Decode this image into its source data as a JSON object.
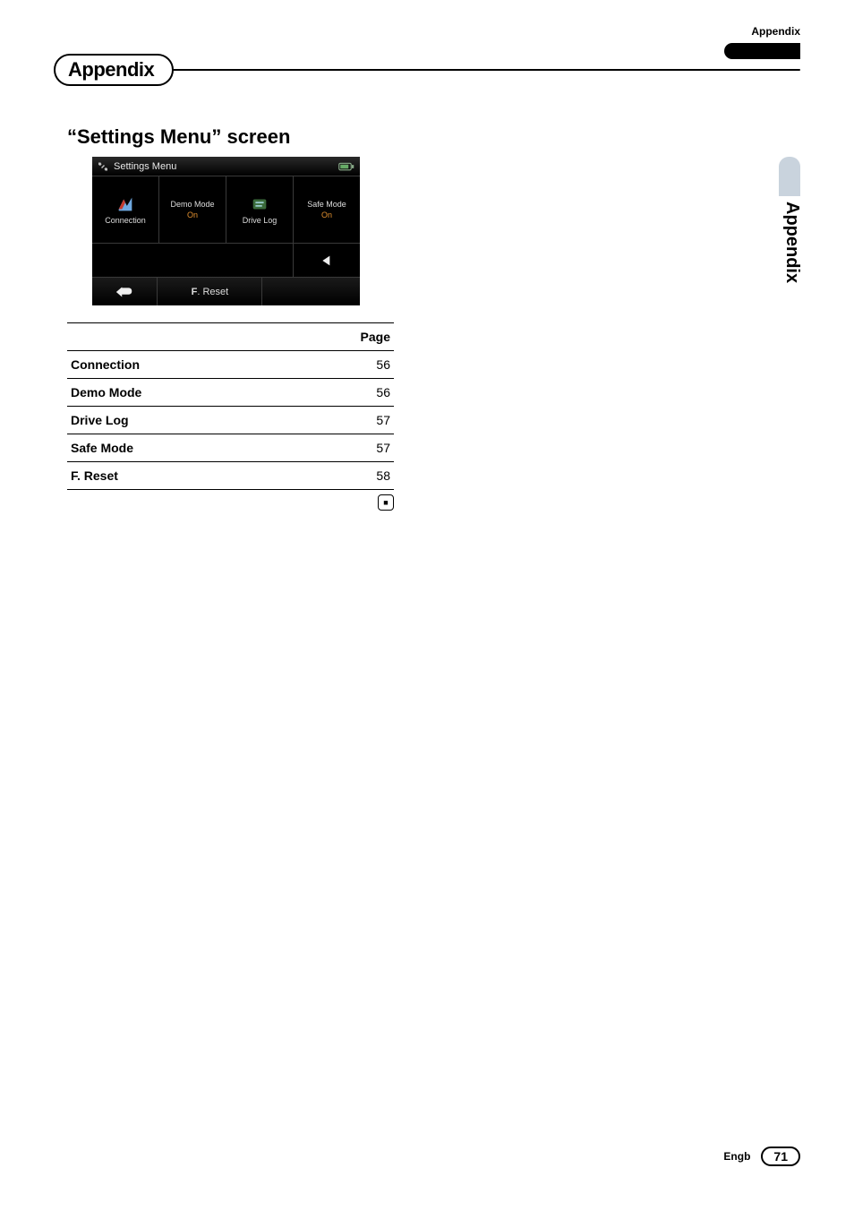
{
  "header": {
    "top_right_label": "Appendix",
    "chapter_title": "Appendix",
    "side_tab": "Appendix"
  },
  "section": {
    "heading_prefix": "“",
    "heading_term": "Settings Menu",
    "heading_suffix": "” screen"
  },
  "screenshot": {
    "title": "Settings Menu",
    "cells": {
      "connection": {
        "label": "Connection"
      },
      "demo_mode": {
        "label": "Demo Mode",
        "value": "On"
      },
      "drive_log": {
        "label": "Drive Log"
      },
      "safe_mode": {
        "label": "Safe Mode",
        "value": "On"
      }
    },
    "freset_prefix": "F",
    "freset_rest": ". Reset"
  },
  "table": {
    "page_header": "Page",
    "rows": [
      {
        "label": "Connection",
        "page": "56"
      },
      {
        "label": "Demo Mode",
        "page": "56"
      },
      {
        "label": "Drive Log",
        "page": "57"
      },
      {
        "label": "Safe Mode",
        "page": "57"
      },
      {
        "label": "F. Reset",
        "page": "58"
      }
    ]
  },
  "end_marker": "■",
  "footer": {
    "lang": "Engb",
    "page_number": "71"
  }
}
